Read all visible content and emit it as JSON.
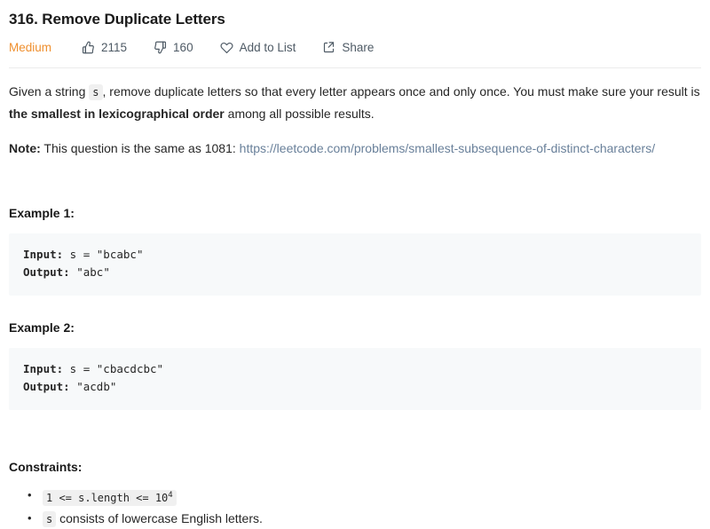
{
  "problem": {
    "title": "316. Remove Duplicate Letters",
    "difficulty": "Medium",
    "difficulty_color": "#ef8f2e"
  },
  "actions": {
    "likes": "2115",
    "dislikes": "160",
    "add_to_list": "Add to List",
    "share": "Share"
  },
  "description": {
    "line1_pre": "Given a string ",
    "var_s": "s",
    "line1_mid": ", remove duplicate letters so that every letter appears once and only once. You must make sure your result is ",
    "line1_bold": "the smallest in lexicographical order",
    "line1_post": " among all possible results.",
    "note_label": "Note:",
    "note_text": " This question is the same as 1081: ",
    "note_link": "https://leetcode.com/problems/smallest-subsequence-of-distinct-characters/"
  },
  "examples": [
    {
      "heading": "Example 1:",
      "input_label": "Input:",
      "input_value": " s = \"bcabc\"",
      "output_label": "Output:",
      "output_value": " \"abc\""
    },
    {
      "heading": "Example 2:",
      "input_label": "Input:",
      "input_value": " s = \"cbacdcbc\"",
      "output_label": "Output:",
      "output_value": " \"acdb\""
    }
  ],
  "constraints": {
    "heading": "Constraints:",
    "item1_code_pre": "1 <= s.length <= 10",
    "item1_code_sup": "4",
    "item2_code": "s",
    "item2_text": " consists of lowercase English letters."
  }
}
